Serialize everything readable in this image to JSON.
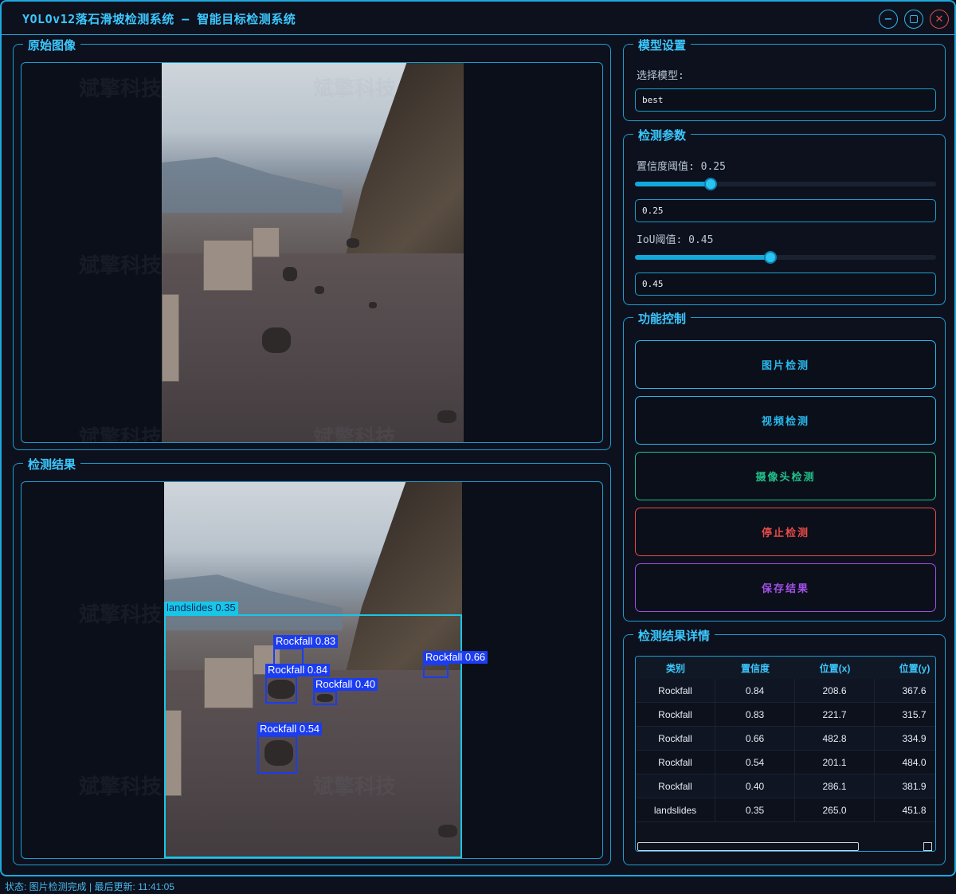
{
  "window": {
    "title": "YOLOv12落石滑坡检测系统 – 智能目标检测系统",
    "watermark_text": "斌擎科技"
  },
  "original_panel": {
    "title": "原始图像"
  },
  "result_panel": {
    "title": "检测结果",
    "detections": [
      {
        "label": "landslides 0.35"
      },
      {
        "label": "Rockfall 0.83"
      },
      {
        "label": "Rockfall 0.84"
      },
      {
        "label": "Rockfall 0.40"
      },
      {
        "label": "Rockfall 0.66"
      },
      {
        "label": "Rockfall 0.54"
      }
    ]
  },
  "model_settings": {
    "title": "模型设置",
    "select_label": "选择模型:",
    "selected_model": "best"
  },
  "params": {
    "title": "检测参数",
    "confidence_label": "置信度阈值: 0.25",
    "confidence_value": "0.25",
    "confidence_fraction": 0.25,
    "iou_label": "IoU阈值: 0.45",
    "iou_value": "0.45",
    "iou_fraction": 0.45
  },
  "controls": {
    "title": "功能控制",
    "image_detect": "图片检测",
    "video_detect": "视频检测",
    "camera_detect": "摄像头检测",
    "stop_detect": "停止检测",
    "save_result": "保存结果",
    "colors": {
      "image_detect": "#29b9ef",
      "video_detect": "#29b9ef",
      "camera_detect": "#21c08a",
      "stop_detect": "#e84a4a",
      "save_result": "#a050e8"
    }
  },
  "details": {
    "title": "检测结果详情",
    "columns": [
      "类别",
      "置信度",
      "位置(x)",
      "位置(y)"
    ],
    "rows": [
      [
        "Rockfall",
        "0.84",
        "208.6",
        "367.6"
      ],
      [
        "Rockfall",
        "0.83",
        "221.7",
        "315.7"
      ],
      [
        "Rockfall",
        "0.66",
        "482.8",
        "334.9"
      ],
      [
        "Rockfall",
        "0.54",
        "201.1",
        "484.0"
      ],
      [
        "Rockfall",
        "0.40",
        "286.1",
        "381.9"
      ],
      [
        "landslides",
        "0.35",
        "265.0",
        "451.8"
      ]
    ]
  },
  "status": {
    "text": "状态: 图片检测完成 | 最后更新: 11:41:05"
  }
}
